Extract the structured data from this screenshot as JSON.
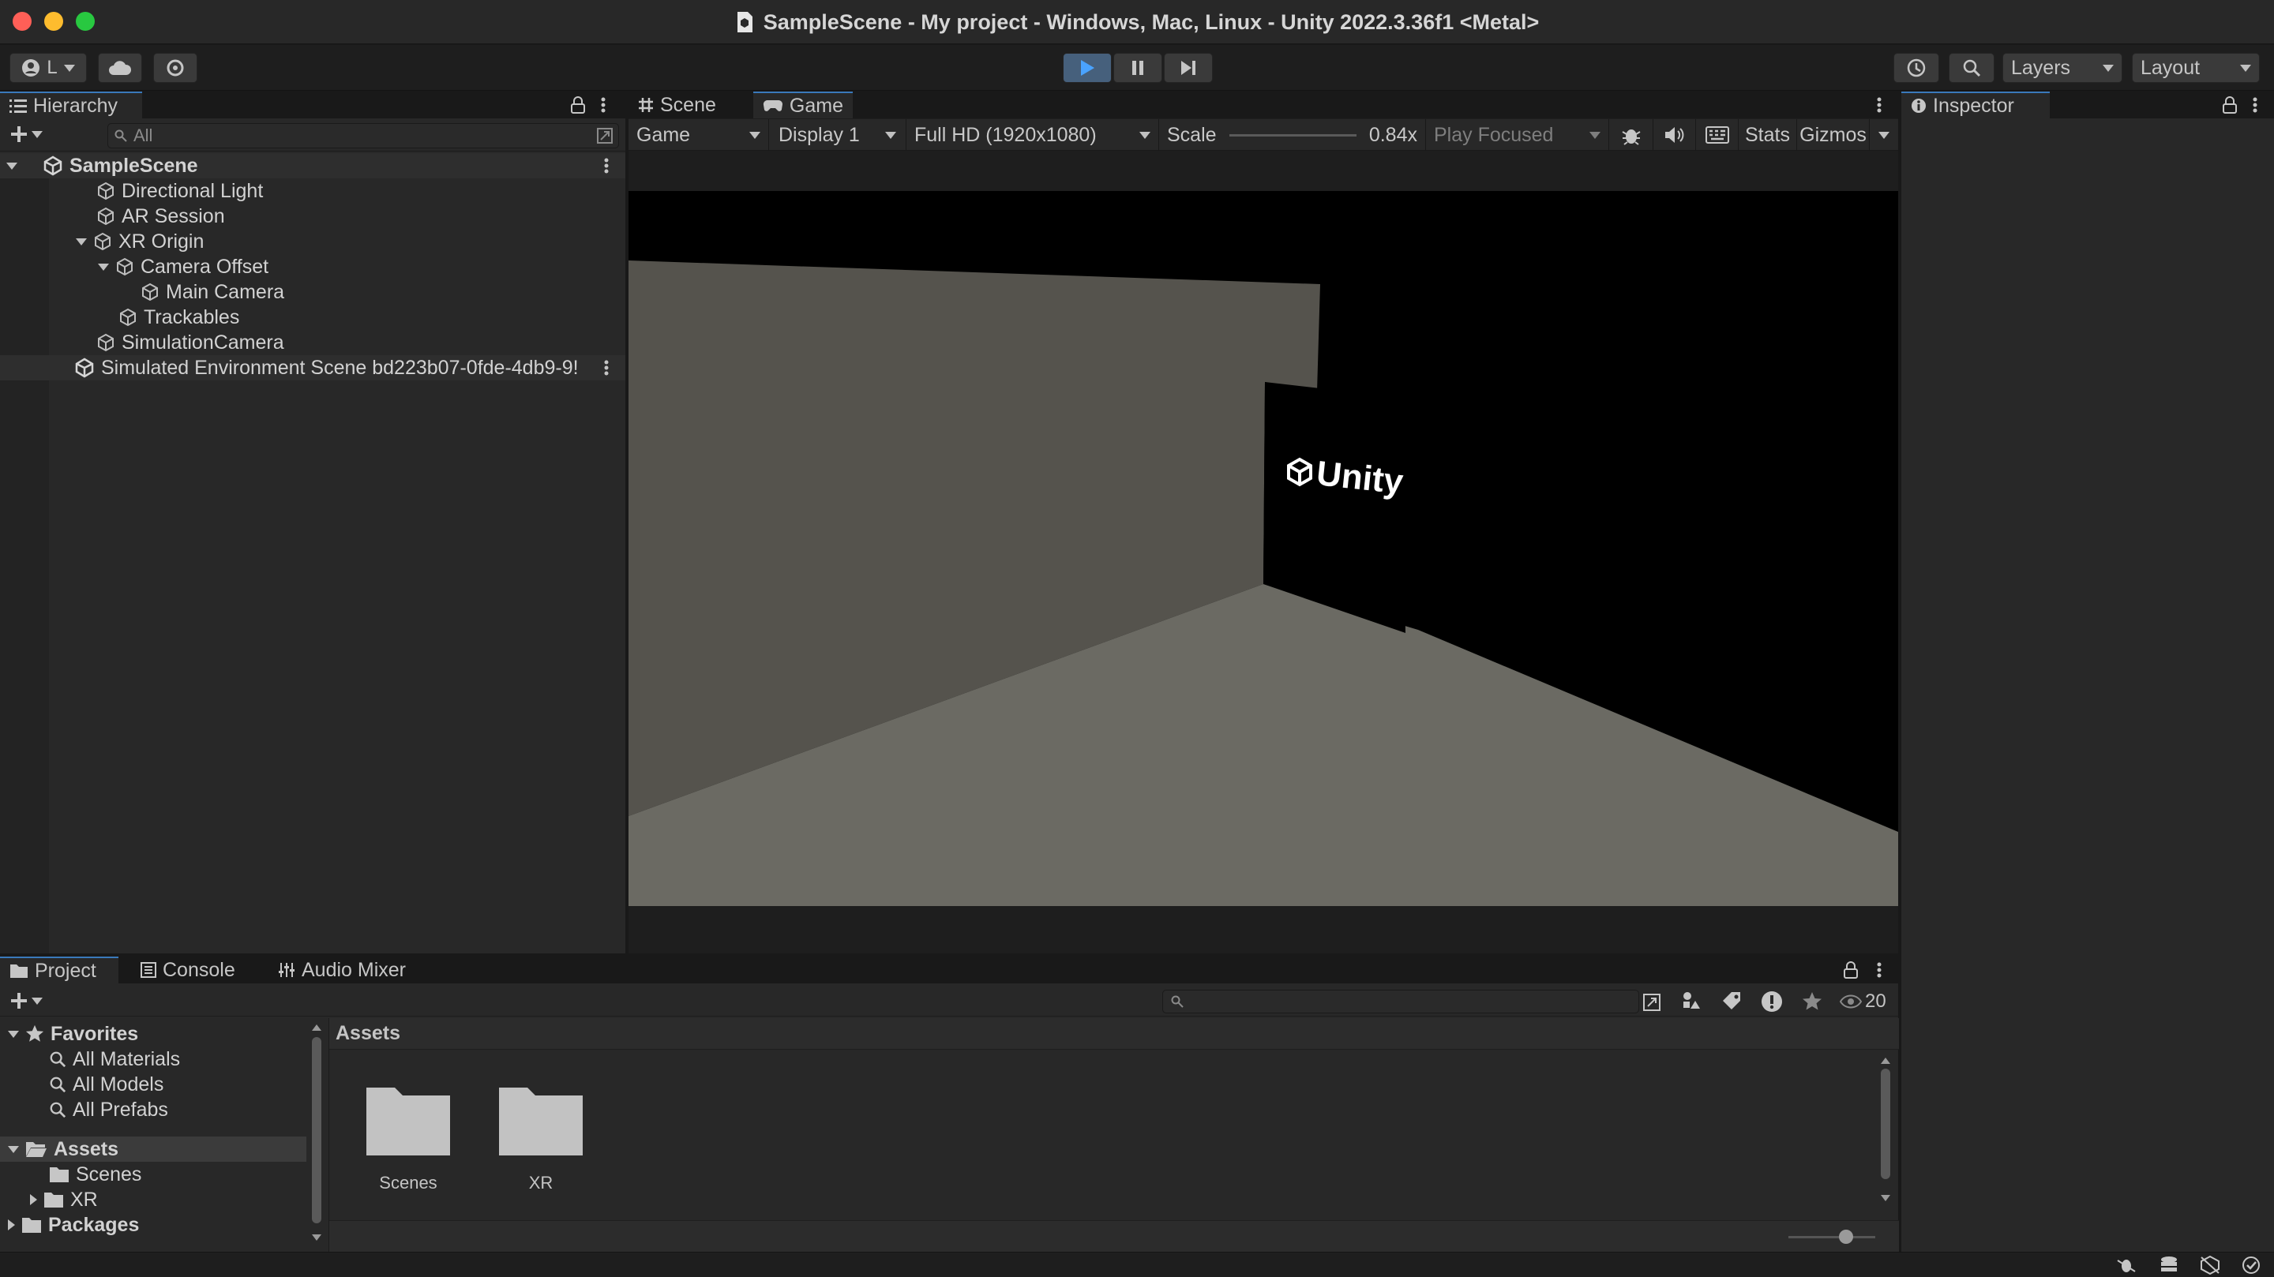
{
  "window": {
    "title": "SampleScene - My project - Windows, Mac, Linux - Unity 2022.3.36f1 <Metal>"
  },
  "toolbar": {
    "account_label": "L",
    "layers_label": "Layers",
    "layout_label": "Layout"
  },
  "hierarchy": {
    "tab_label": "Hierarchy",
    "search_placeholder": "All",
    "items": [
      {
        "label": "SampleScene"
      },
      {
        "label": "Directional Light"
      },
      {
        "label": "AR Session"
      },
      {
        "label": "XR Origin"
      },
      {
        "label": "Camera Offset"
      },
      {
        "label": "Main Camera"
      },
      {
        "label": "Trackables"
      },
      {
        "label": "SimulationCamera"
      },
      {
        "label": "Simulated Environment Scene bd223b07-0fde-4db9-9!"
      }
    ]
  },
  "center": {
    "tabs": [
      {
        "label": "Scene"
      },
      {
        "label": "Game"
      }
    ],
    "game_bar": {
      "view_mode": "Game",
      "display": "Display 1",
      "resolution": "Full HD (1920x1080)",
      "scale_label": "Scale",
      "scale_value": "0.84x",
      "play_mode": "Play Focused",
      "stats_label": "Stats",
      "gizmos_label": "Gizmos"
    },
    "viewport_logo_text": "Unity"
  },
  "inspector": {
    "tab_label": "Inspector"
  },
  "project": {
    "tabs": [
      {
        "label": "Project"
      },
      {
        "label": "Console"
      },
      {
        "label": "Audio Mixer"
      }
    ],
    "hidden_count": "20",
    "tree": {
      "favorites_label": "Favorites",
      "favorites": [
        "All Materials",
        "All Models",
        "All Prefabs"
      ],
      "assets_label": "Assets",
      "assets_children": [
        "Scenes",
        "XR"
      ],
      "packages_label": "Packages"
    },
    "breadcrumb": "Assets",
    "grid_items": [
      {
        "label": "Scenes"
      },
      {
        "label": "XR"
      }
    ]
  },
  "colors": {
    "accent": "#3a79bb",
    "panel": "#282828",
    "viewport_floor": "#6b6a63",
    "viewport_wall": "#55534d"
  }
}
